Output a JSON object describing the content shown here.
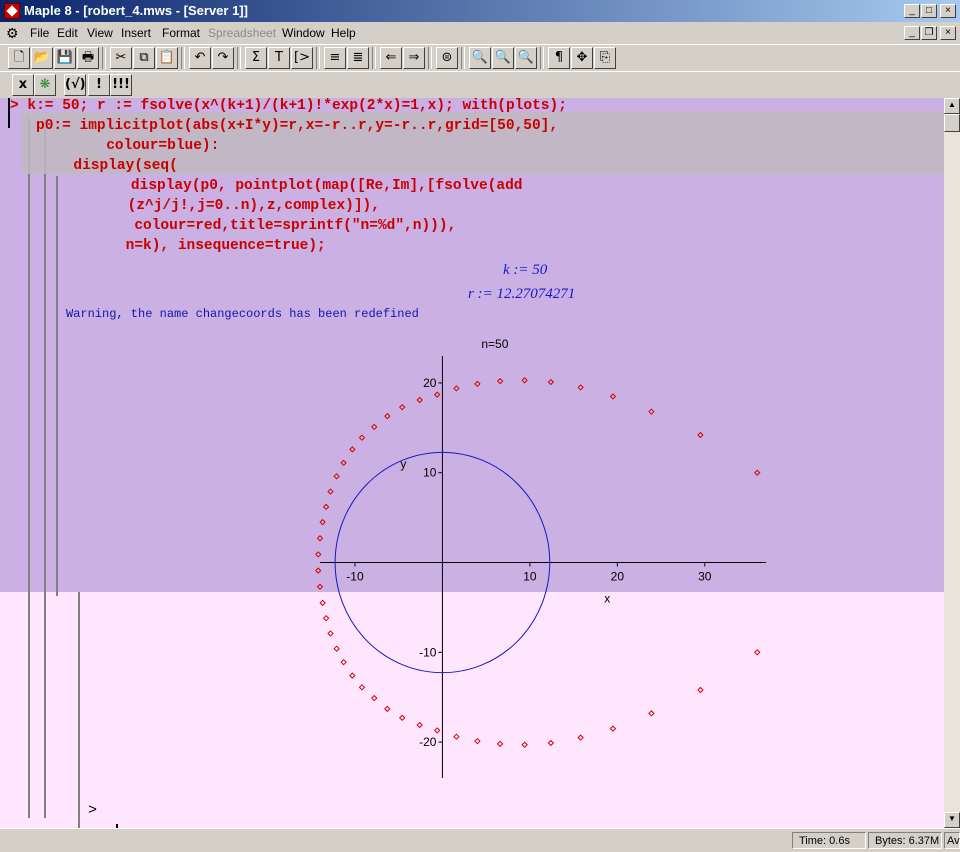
{
  "window": {
    "title": "Maple 8 - [robert_4.mws - [Server 1]]",
    "controls": [
      "_",
      "□",
      "×"
    ],
    "doc_controls": [
      "_",
      "❐",
      "×"
    ]
  },
  "menu": [
    "File",
    "Edit",
    "View",
    "Insert",
    "Format",
    "Spreadsheet",
    "Window",
    "Help"
  ],
  "menu_disabled": [
    "Spreadsheet"
  ],
  "toolbar1": [
    {
      "name": "new-icon",
      "glyph": "🗋"
    },
    {
      "name": "open-icon",
      "glyph": "📂"
    },
    {
      "name": "save-icon",
      "glyph": "💾"
    },
    {
      "name": "print-icon",
      "glyph": "🖶"
    },
    {
      "name": "cut-icon",
      "glyph": "✂"
    },
    {
      "name": "copy-icon",
      "glyph": "⧉"
    },
    {
      "name": "paste-icon",
      "glyph": "📋"
    },
    {
      "name": "undo-icon",
      "glyph": "↶"
    },
    {
      "name": "redo-icon",
      "glyph": "↷"
    },
    {
      "name": "sum-icon",
      "glyph": "Σ"
    },
    {
      "name": "text-icon",
      "glyph": "T"
    },
    {
      "name": "prompt-icon",
      "glyph": "[>"
    },
    {
      "name": "indent-icon",
      "glyph": "≡"
    },
    {
      "name": "outdent-icon",
      "glyph": "≣"
    },
    {
      "name": "back-icon",
      "glyph": "⇐"
    },
    {
      "name": "forward-icon",
      "glyph": "⇒"
    },
    {
      "name": "stop-icon",
      "glyph": "⊜"
    },
    {
      "name": "zoom-100-icon",
      "glyph": "🔍"
    },
    {
      "name": "zoom-150-icon",
      "glyph": "🔍"
    },
    {
      "name": "zoom-200-icon",
      "glyph": "🔍"
    },
    {
      "name": "pilcrow-icon",
      "glyph": "¶"
    },
    {
      "name": "expand-icon",
      "glyph": "✥"
    },
    {
      "name": "restart-icon",
      "glyph": "⎘"
    }
  ],
  "toolbar2": [
    {
      "name": "math-x-icon",
      "glyph": "x"
    },
    {
      "name": "maple-leaf-icon",
      "glyph": "❋"
    },
    {
      "name": "check-syntax-icon",
      "glyph": "(√)"
    },
    {
      "name": "execute-icon",
      "glyph": "!"
    },
    {
      "name": "execute-all-icon",
      "glyph": "!!!"
    }
  ],
  "input_lines": [
    "> k:= 50; r := fsolve(x^(k+1)/(k+1)!*exp(2*x)=1,x); with(plots);",
    "p0:= implicitplot(abs(x+I*y)=r,x=-r..r,y=-r..r,grid=[50,50],",
    "      colour=blue):",
    "  display(seq(",
    "       display(p0, pointplot(map([Re,Im],[fsolve(add",
    "        (z^j/j!,j=0..n),z,complex)]),",
    "         colour=red,title=sprintf(\"n=%d\",n))),",
    "        n=k), insequence=true);"
  ],
  "outputs": {
    "k_line": "k := 50",
    "r_line": "r := 12.27074271",
    "warning": "Warning, the name changecoords has been redefined"
  },
  "chart_data": {
    "type": "scatter",
    "title": "n=50",
    "xlabel": "x",
    "ylabel": "y",
    "xlim": [
      -14,
      37
    ],
    "ylim": [
      -24,
      23
    ],
    "xticks": [
      -10,
      10,
      20,
      30
    ],
    "yticks": [
      -20,
      -10,
      10,
      20
    ],
    "circle": {
      "cx": 0,
      "cy": 0,
      "r": 12.27074271,
      "color": "#1818c0"
    },
    "points_color": "#d80000",
    "points": [
      [
        -14.2,
        0.9
      ],
      [
        -14.2,
        -0.9
      ],
      [
        -14.0,
        2.7
      ],
      [
        -14.0,
        -2.7
      ],
      [
        -13.7,
        4.5
      ],
      [
        -13.7,
        -4.5
      ],
      [
        -13.3,
        6.2
      ],
      [
        -13.3,
        -6.2
      ],
      [
        -12.8,
        7.9
      ],
      [
        -12.8,
        -7.9
      ],
      [
        -12.1,
        9.6
      ],
      [
        -12.1,
        -9.6
      ],
      [
        -11.3,
        11.1
      ],
      [
        -11.3,
        -11.1
      ],
      [
        -10.3,
        12.6
      ],
      [
        -10.3,
        -12.6
      ],
      [
        -9.2,
        13.9
      ],
      [
        -9.2,
        -13.9
      ],
      [
        -7.8,
        15.1
      ],
      [
        -7.8,
        -15.1
      ],
      [
        -6.3,
        16.3
      ],
      [
        -6.3,
        -16.3
      ],
      [
        -4.6,
        17.3
      ],
      [
        -4.6,
        -17.3
      ],
      [
        -2.6,
        18.1
      ],
      [
        -2.6,
        -18.1
      ],
      [
        -0.6,
        18.7
      ],
      [
        -0.6,
        -18.7
      ],
      [
        1.6,
        19.4
      ],
      [
        1.6,
        -19.4
      ],
      [
        4.0,
        19.9
      ],
      [
        4.0,
        -19.9
      ],
      [
        6.6,
        20.2
      ],
      [
        6.6,
        -20.2
      ],
      [
        9.4,
        20.3
      ],
      [
        9.4,
        -20.3
      ],
      [
        12.4,
        20.1
      ],
      [
        12.4,
        -20.1
      ],
      [
        15.8,
        19.5
      ],
      [
        15.8,
        -19.5
      ],
      [
        19.5,
        18.5
      ],
      [
        19.5,
        -18.5
      ],
      [
        23.9,
        16.8
      ],
      [
        23.9,
        -16.8
      ],
      [
        29.5,
        14.2
      ],
      [
        29.5,
        -14.2
      ],
      [
        36.0,
        10.0
      ],
      [
        36.0,
        -10.0
      ]
    ]
  },
  "status": {
    "time": "Time:   0.6s",
    "bytes": "Bytes: 6.37M",
    "avail": "Av"
  },
  "bottom_prompt": ">"
}
